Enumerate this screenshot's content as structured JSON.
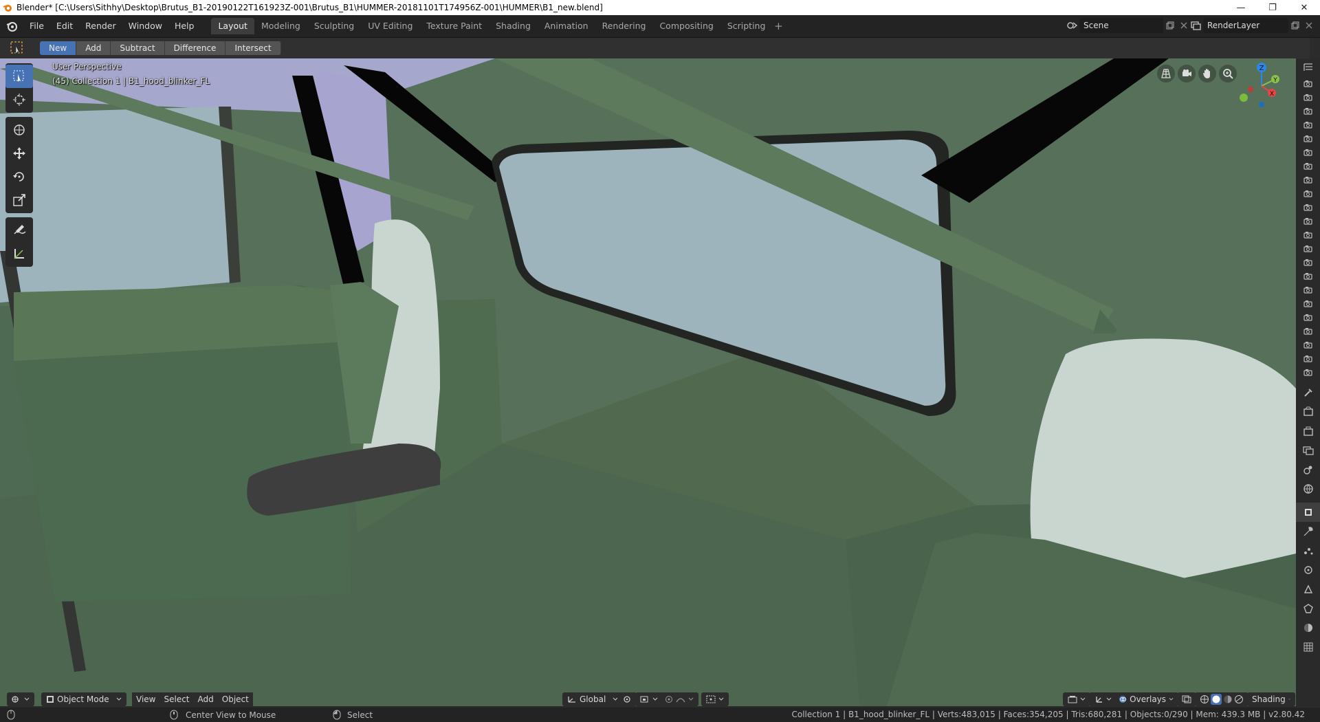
{
  "window": {
    "title": "Blender* [C:\\Users\\Sithhy\\Desktop\\Brutus_B1-20190122T161923Z-001\\Brutus_B1\\HUMMER-20181101T174956Z-001\\HUMMER\\B1_new.blend]",
    "minimize": "—",
    "restore": "❐",
    "close": "✕"
  },
  "menu": [
    "File",
    "Edit",
    "Render",
    "Window",
    "Help"
  ],
  "workspaces": {
    "tabs": [
      "Layout",
      "Modeling",
      "Sculpting",
      "UV Editing",
      "Texture Paint",
      "Shading",
      "Animation",
      "Rendering",
      "Compositing",
      "Scripting"
    ],
    "active": "Layout",
    "add": "+"
  },
  "scene": {
    "name": "Scene",
    "view_layer": "RenderLayer"
  },
  "tool_settings": {
    "buttons": [
      "New",
      "Add",
      "Subtract",
      "Difference",
      "Intersect"
    ],
    "active": "New"
  },
  "viewport": {
    "perspective": "User Perspective",
    "collection_info": "(45) Collection 1 | B1_hood_blinker_FL",
    "gizmo": {
      "z": "Z",
      "y": "Y",
      "x": "X"
    }
  },
  "header": {
    "mode": "Object Mode",
    "menus": [
      "View",
      "Select",
      "Add",
      "Object"
    ],
    "orientation": "Global",
    "overlays": "Overlays",
    "shading": "Shading"
  },
  "status": {
    "middle_mouse": "Center View to Mouse",
    "left_mouse": "Select",
    "stats": "Collection 1 | B1_hood_blinker_FL | Verts:483,015 | Faces:354,205 | Tris:680,281 | Objects:0/290 | Mem: 439.3 MB | v2.80.42"
  },
  "colors": {
    "accent": "#4772b3",
    "interior_green": "#56705a",
    "window_glass": "#9eb4bd",
    "seat_pale": "#c9d6d0"
  }
}
